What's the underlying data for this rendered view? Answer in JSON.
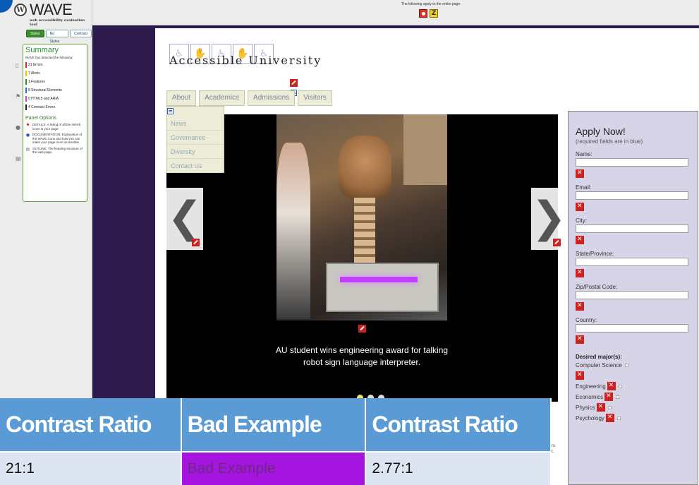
{
  "wave": {
    "logo_text": "WAVE",
    "tagline": "web accessibility evaluation tool",
    "views": [
      "Styles",
      "No Styles",
      "Contrast"
    ],
    "summary": {
      "title": "Summary",
      "intro": "WAVE has detected the following:",
      "items": [
        {
          "label": "21 Errors",
          "color": "#d32f2f"
        },
        {
          "label": "7 Alerts",
          "color": "#f0c020"
        },
        {
          "label": "1 Features",
          "color": "#2e8b2e"
        },
        {
          "label": "8 Structural Elements",
          "color": "#2a6fd6"
        },
        {
          "label": "0 HTML5 and ARIA",
          "color": "#b04ad8"
        },
        {
          "label": "4 Contrast Errors",
          "color": "#222222"
        }
      ]
    },
    "panel_options": {
      "title": "Panel Options",
      "options": [
        {
          "icon": "flag-icon",
          "text": "DETAILS: A listing of all the WAVE icons in your page."
        },
        {
          "icon": "info-icon",
          "text": "DOCUMENTATION: Explanation of the WAVE icons and how you can make your page more accessible."
        },
        {
          "icon": "outline-icon",
          "text": "OUTLINE: The heading structure of the web page."
        }
      ]
    },
    "topbar_text": "The following apply to the entire page:"
  },
  "site": {
    "name": "Accessible University",
    "nav_tabs": [
      "About",
      "Academics",
      "Admissions",
      "Visitors"
    ],
    "dropdown": [
      "News",
      "Governance",
      "Diversity",
      "Contact Us"
    ],
    "caption": "AU student wins engineering award for talking robot sign language interpreter.",
    "slider_dots": 3,
    "left_arrow": "❮",
    "right_arrow": "❯"
  },
  "apply_form": {
    "title": "Apply Now!",
    "note": "(required fields are in blue)",
    "fields": [
      "Name:",
      "Email:",
      "City:",
      "State/Province:",
      "Zip/Postal Code:",
      "Country:"
    ],
    "majors_title": "Desired major(s):",
    "majors": [
      "Computer Science",
      "Engineering",
      "Economics",
      "Physics",
      "Psychology"
    ]
  },
  "contrast_table": {
    "headers": [
      "Contrast Ratio",
      "Bad Example",
      "Contrast Ratio"
    ],
    "row": [
      "21:1",
      "Bad Example",
      "2.77:1"
    ]
  },
  "cut_text": [
    "rs",
    "t."
  ]
}
